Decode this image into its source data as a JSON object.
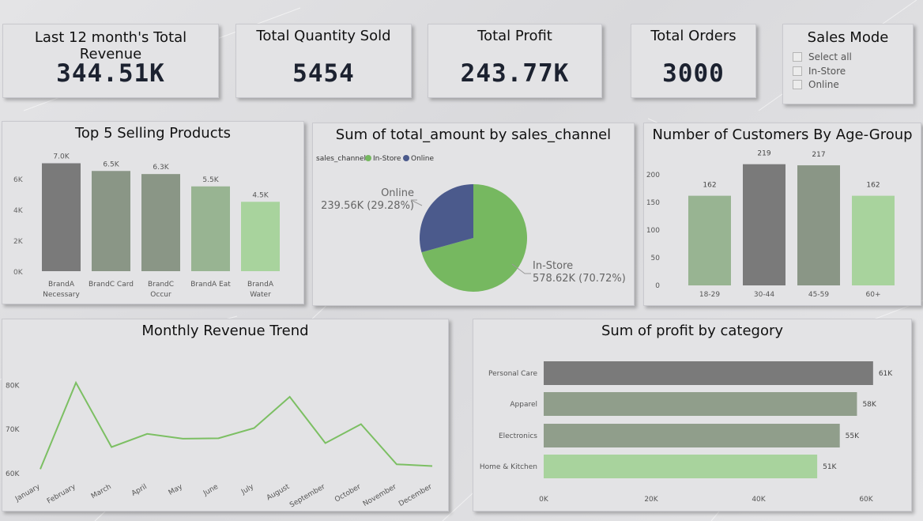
{
  "kpis": {
    "revenue": {
      "title": "Last 12 month's Total Revenue",
      "value": "344.51K"
    },
    "quantity": {
      "title": "Total Quantity Sold",
      "value": "5454"
    },
    "profit": {
      "title": "Total Profit",
      "value": "243.77K"
    },
    "orders": {
      "title": "Total Orders",
      "value": "3000"
    }
  },
  "slicer": {
    "title": "Sales Mode",
    "items": [
      "Select all",
      "In-Store",
      "Online"
    ]
  },
  "colors": {
    "dark_gray": "#7a7a7a",
    "gray_green": "#8a9686",
    "sage": "#909e8b",
    "mid_green": "#98b492",
    "light_green": "#a8d39d",
    "pie_instore": "#76b860",
    "pie_online": "#4b5a8c",
    "line_green": "#7cbf63"
  },
  "chart_data": [
    {
      "id": "top5",
      "type": "bar",
      "title": "Top 5 Selling Products",
      "categories": [
        [
          "BrandA",
          "Necessary"
        ],
        [
          "BrandC Card"
        ],
        [
          "BrandC",
          "Occur"
        ],
        [
          "BrandA Eat"
        ],
        [
          "BrandA",
          "Water"
        ]
      ],
      "values": [
        7.0,
        6.5,
        6.3,
        5.5,
        4.5
      ],
      "data_labels": [
        "7.0K",
        "6.5K",
        "6.3K",
        "5.5K",
        "4.5K"
      ],
      "yticks": [
        "0K",
        "2K",
        "4K",
        "6K"
      ],
      "ylim": [
        0,
        8
      ],
      "bar_colors": [
        "#7a7a7a",
        "#8a9686",
        "#8a9686",
        "#98b492",
        "#a8d39d"
      ]
    },
    {
      "id": "channel",
      "type": "pie",
      "title": "Sum of total_amount by sales_channel",
      "legend_title": "sales_channel",
      "slices": [
        {
          "name": "In-Store",
          "value": 578.62,
          "label": "578.62K (70.72%)",
          "percent": 70.72
        },
        {
          "name": "Online",
          "value": 239.56,
          "label": "239.56K (29.28%)",
          "percent": 29.28
        }
      ]
    },
    {
      "id": "age",
      "type": "bar",
      "title": "Number of Customers By Age-Group",
      "categories": [
        "18-29",
        "30-44",
        "45-59",
        "60+"
      ],
      "values": [
        162,
        219,
        217,
        162
      ],
      "yticks": [
        "0",
        "50",
        "100",
        "150",
        "200"
      ],
      "ylim": [
        0,
        240
      ],
      "bar_colors": [
        "#98b492",
        "#7a7a7a",
        "#8a9686",
        "#a8d39d"
      ]
    },
    {
      "id": "monthly",
      "type": "line",
      "title": "Monthly Revenue Trend",
      "x": [
        "January",
        "February",
        "March",
        "April",
        "May",
        "June",
        "July",
        "August",
        "September",
        "October",
        "November",
        "December"
      ],
      "values": [
        60.8,
        80.4,
        65.8,
        68.8,
        67.7,
        67.8,
        70.1,
        77.2,
        66.7,
        71.0,
        61.9,
        61.5
      ],
      "yticks": [
        "60K",
        "70K",
        "80K"
      ],
      "ylim": [
        58,
        84
      ]
    },
    {
      "id": "profitcat",
      "type": "bar",
      "orientation": "horizontal",
      "title": "Sum of profit by category",
      "categories": [
        "Personal Care",
        "Apparel",
        "Electronics",
        "Home & Kitchen"
      ],
      "values": [
        61.3,
        58.3,
        55.1,
        50.9
      ],
      "data_labels": [
        "61K",
        "58K",
        "55K",
        "51K"
      ],
      "xticks": [
        "0K",
        "20K",
        "40K",
        "60K"
      ],
      "xlim": [
        0,
        60
      ],
      "bar_colors": [
        "#7a7a7a",
        "#909e8b",
        "#909e8b",
        "#a8d39d"
      ]
    }
  ]
}
